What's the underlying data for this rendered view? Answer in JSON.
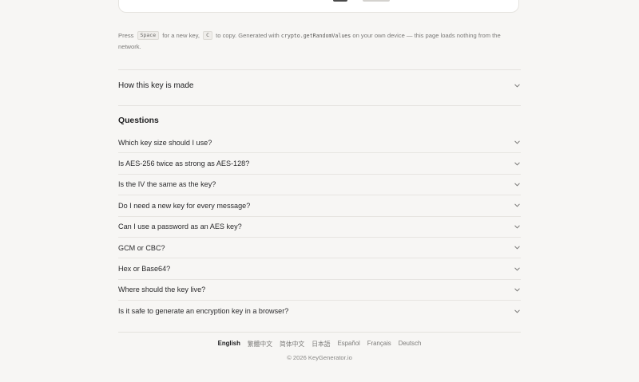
{
  "hint": {
    "press": "Press",
    "space_key": "Space",
    "for_new_key": "for a new key,",
    "copy_key": "C",
    "to_copy": "to copy. Generated with",
    "api": "crypto.getRandomValues",
    "rest": "on your own device — this page loads nothing from the network."
  },
  "how_section": {
    "title": "How this key is made"
  },
  "questions": {
    "title": "Questions",
    "items": [
      {
        "label": "Which key size should I use?"
      },
      {
        "label": "Is AES-256 twice as strong as AES-128?"
      },
      {
        "label": "Is the IV the same as the key?"
      },
      {
        "label": "Do I need a new key for every message?"
      },
      {
        "label": "Can I use a password as an AES key?"
      },
      {
        "label": "GCM or CBC?"
      },
      {
        "label": "Hex or Base64?"
      },
      {
        "label": "Where should the key live?"
      },
      {
        "label": "Is it safe to generate an encryption key in a browser?"
      }
    ]
  },
  "footer": {
    "languages": [
      {
        "label": "English",
        "active": true
      },
      {
        "label": "繁體中文",
        "active": false
      },
      {
        "label": "简体中文",
        "active": false
      },
      {
        "label": "日本語",
        "active": false
      },
      {
        "label": "Español",
        "active": false
      },
      {
        "label": "Français",
        "active": false
      },
      {
        "label": "Deutsch",
        "active": false
      }
    ],
    "copyright": "© 2026 KeyGenerator.io"
  },
  "icons": {
    "chevron": "chevron-down-icon"
  },
  "colors": {
    "background": "#f7f6f4",
    "text": "#1d1d1f",
    "muted": "#7b7a78",
    "divider": "#e4e2de"
  }
}
